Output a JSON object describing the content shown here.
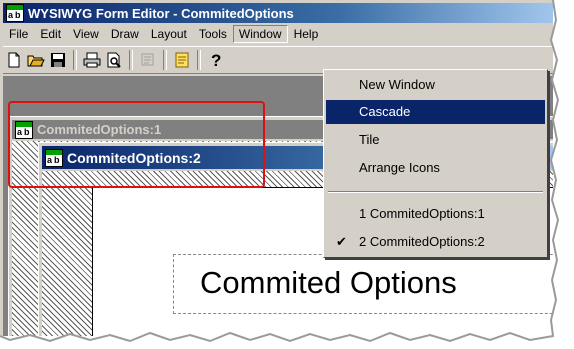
{
  "app": {
    "title": "WYSIWYG Form Editor - CommitedOptions"
  },
  "menubar": {
    "items": [
      {
        "label": "File"
      },
      {
        "label": "Edit"
      },
      {
        "label": "View"
      },
      {
        "label": "Draw"
      },
      {
        "label": "Layout"
      },
      {
        "label": "Tools"
      },
      {
        "label": "Window"
      },
      {
        "label": "Help"
      }
    ],
    "open": "Window"
  },
  "toolbar": {
    "icons": [
      "new-document-icon",
      "open-folder-icon",
      "save-disk-icon",
      "print-icon",
      "print-preview-icon",
      "disabled-tool-icon",
      "form-icon",
      "help-icon"
    ]
  },
  "windows": {
    "first": {
      "title": "CommitedOptions:1"
    },
    "second": {
      "title": "CommitedOptions:2"
    }
  },
  "form": {
    "label": "Commited Options"
  },
  "window_menu": {
    "items": [
      {
        "label": "New Window",
        "selected": false
      },
      {
        "label": "Cascade",
        "selected": true
      },
      {
        "label": "Tile",
        "selected": false
      },
      {
        "label": "Arrange Icons",
        "selected": false
      },
      {
        "label": "1 CommitedOptions:1",
        "selected": false
      },
      {
        "label": "2 CommitedOptions:2",
        "selected": false,
        "checked": true
      }
    ]
  },
  "colors": {
    "highlight": "#e01010",
    "titlebar_active": "#0a246a",
    "selection": "#0a246a"
  }
}
